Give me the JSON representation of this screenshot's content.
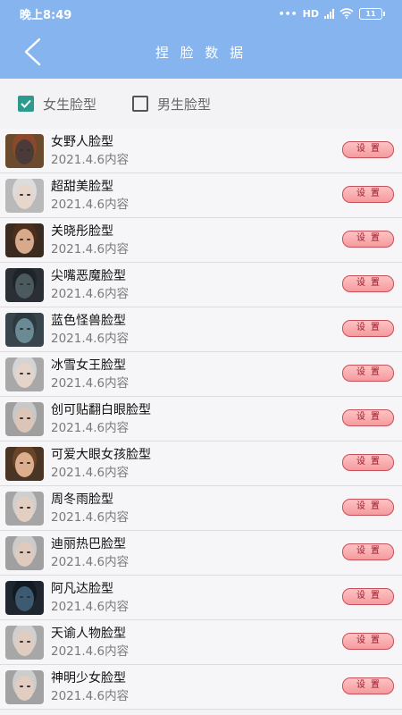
{
  "status_bar": {
    "time": "晚上8:49",
    "network": "HD",
    "battery": "11"
  },
  "header": {
    "title": "捏 脸 数 据"
  },
  "filters": [
    {
      "label": "女生脸型",
      "checked": true
    },
    {
      "label": "男生脸型",
      "checked": false
    }
  ],
  "button_label": "设置",
  "items": [
    {
      "name": "女野人脸型",
      "date": "2021.4.6内容",
      "bg": "#6b4a2e",
      "skin": "#4a3a38",
      "hair": "#8a4a2a"
    },
    {
      "name": "超甜美脸型",
      "date": "2021.4.6内容",
      "bg": "#b9b9b9",
      "skin": "#e7d6cc",
      "hair": "#dcdcdc"
    },
    {
      "name": "关晓彤脸型",
      "date": "2021.4.6内容",
      "bg": "#3a2a20",
      "skin": "#d8a98a",
      "hair": "#4b2e1c"
    },
    {
      "name": "尖嘴恶魔脸型",
      "date": "2021.4.6内容",
      "bg": "#2a2f36",
      "skin": "#4b5a5e",
      "hair": "#1f2428"
    },
    {
      "name": "蓝色怪兽脸型",
      "date": "2021.4.6内容",
      "bg": "#39454c",
      "skin": "#6a8a96",
      "hair": "#2c3a40"
    },
    {
      "name": "冰雪女王脸型",
      "date": "2021.4.6内容",
      "bg": "#a8a8a8",
      "skin": "#e5d4c9",
      "hair": "#d4d4d4"
    },
    {
      "name": "创可贴翻白眼脸型",
      "date": "2021.4.6内容",
      "bg": "#9f9f9f",
      "skin": "#dcc4b6",
      "hair": "#c8c8c8"
    },
    {
      "name": "可爱大眼女孩脸型",
      "date": "2021.4.6内容",
      "bg": "#4a3424",
      "skin": "#dcae8e",
      "hair": "#6a4428"
    },
    {
      "name": "周冬雨脸型",
      "date": "2021.4.6内容",
      "bg": "#a5a5a5",
      "skin": "#e2cfc2",
      "hair": "#cfcfcf"
    },
    {
      "name": "迪丽热巴脸型",
      "date": "2021.4.6内容",
      "bg": "#a0a0a0",
      "skin": "#dfcabd",
      "hair": "#cbcbcb"
    },
    {
      "name": "阿凡达脸型",
      "date": "2021.4.6内容",
      "bg": "#1f2630",
      "skin": "#3c5a72",
      "hair": "#141a22"
    },
    {
      "name": "天谕人物脸型",
      "date": "2021.4.6内容",
      "bg": "#a7a7a7",
      "skin": "#e0cdc0",
      "hair": "#d0d0d0"
    },
    {
      "name": "神明少女脸型",
      "date": "2021.4.6内容",
      "bg": "#a2a2a2",
      "skin": "#e1cdc1",
      "hair": "#cdcdcd"
    }
  ]
}
